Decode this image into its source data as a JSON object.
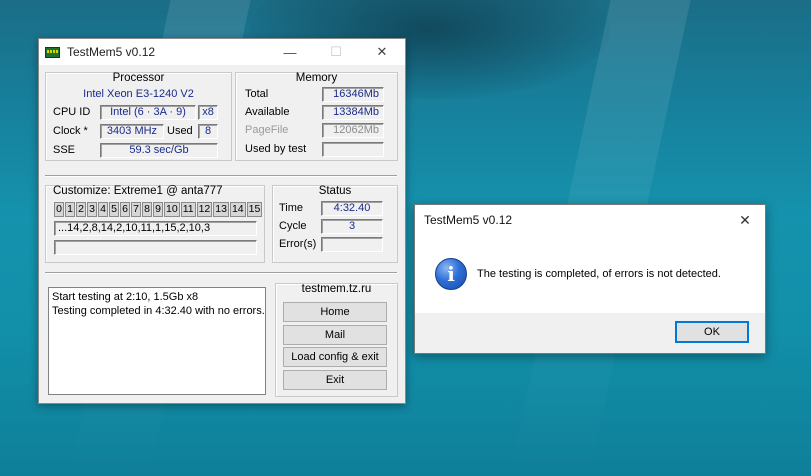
{
  "window": {
    "title": "TestMem5 v0.12",
    "controls": {
      "minimize": "—",
      "maximize": "☐",
      "close": "✕"
    }
  },
  "processor": {
    "title": "Processor",
    "name": "Intel Xeon  E3-1240 V2",
    "cpu_id_label": "CPU ID",
    "cpu_id_value": "Intel  (6 · 3A · 9)",
    "threads_value": "x8",
    "clock_label": "Clock *",
    "clock_value": "3403 MHz",
    "used_label": "Used",
    "used_value": "8",
    "sse_label": "SSE",
    "sse_value": "59.3 sec/Gb"
  },
  "memory": {
    "title": "Memory",
    "total_label": "Total",
    "total_value": "16346Mb",
    "available_label": "Available",
    "available_value": "13384Mb",
    "pagefile_label": "PageFile",
    "pagefile_value": "12062Mb",
    "usedbytest_label": "Used by test",
    "usedbytest_value": ""
  },
  "customize": {
    "title": "Customize: Extreme1 @ anta777",
    "cells": [
      "0",
      "1",
      "2",
      "3",
      "4",
      "5",
      "6",
      "7",
      "8",
      "9",
      "10",
      "11",
      "12",
      "13",
      "14",
      "15"
    ],
    "sequence": "...14,2,8,14,2,10,11,1,15,2,10,3",
    "empty_field": ""
  },
  "status": {
    "title": "Status",
    "time_label": "Time",
    "time_value": "4:32.40",
    "cycle_label": "Cycle",
    "cycle_value": "3",
    "errors_label": "Error(s)",
    "errors_value": ""
  },
  "log": {
    "lines": [
      "Start testing at 2:10, 1.5Gb x8",
      "Testing completed in 4:32.40 with no errors."
    ]
  },
  "actions": {
    "site": "testmem.tz.ru",
    "home": "Home",
    "mail": "Mail",
    "load": "Load config & exit",
    "exit": "Exit"
  },
  "dialog": {
    "title": "TestMem5 v0.12",
    "close": "✕",
    "icon_glyph": "i",
    "message": "The testing is completed, of errors is not detected.",
    "ok": "OK"
  }
}
